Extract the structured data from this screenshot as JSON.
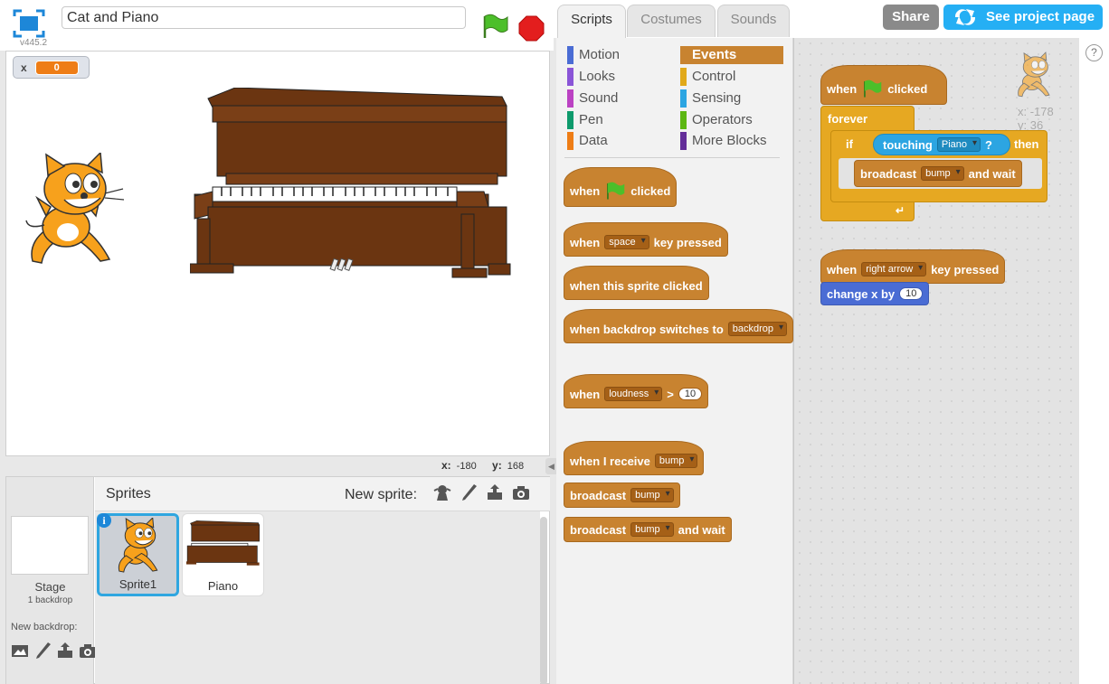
{
  "project": {
    "title": "Cat and Piano",
    "version": "v445.2"
  },
  "stage": {
    "variable": {
      "name": "x",
      "value": "0"
    },
    "coords": {
      "x_label": "x:",
      "x": "-180",
      "y_label": "y:",
      "y": "168"
    }
  },
  "tabs": [
    {
      "label": "Scripts",
      "active": true
    },
    {
      "label": "Costumes",
      "active": false
    },
    {
      "label": "Sounds",
      "active": false
    }
  ],
  "header_buttons": {
    "share": "Share",
    "see_project": "See project page"
  },
  "categories": {
    "left": [
      "Motion",
      "Looks",
      "Sound",
      "Pen",
      "Data"
    ],
    "right": [
      "Events",
      "Control",
      "Sensing",
      "Operators",
      "More Blocks"
    ],
    "colors": {
      "Motion": "#4a6cd4",
      "Looks": "#8a55d7",
      "Sound": "#bb42c3",
      "Pen": "#0e9a6c",
      "Data": "#ee7d16",
      "Events": "#c88330",
      "Control": "#e1a91a",
      "Sensing": "#2ca5e2",
      "Operators": "#5cb712",
      "More Blocks": "#632d99"
    },
    "active": "Events"
  },
  "palette_blocks": {
    "when_flag": {
      "when": "when",
      "clicked": "clicked"
    },
    "key_pressed": {
      "when": "when",
      "key": "space",
      "suffix": "key pressed"
    },
    "sprite_clicked": "when this sprite clicked",
    "backdrop_switch": {
      "text": "when backdrop switches to",
      "value": "backdrop"
    },
    "loudness": {
      "when": "when",
      "sensor": "loudness",
      "op": ">",
      "value": "10"
    },
    "receive": {
      "text": "when I receive",
      "value": "bump"
    },
    "broadcast": {
      "text": "broadcast",
      "value": "bump"
    },
    "broadcast_wait": {
      "text": "broadcast",
      "value": "bump",
      "suffix": "and wait"
    }
  },
  "script": {
    "sprite_x": "x: -178",
    "sprite_y": "y: 36",
    "hat_when": "when",
    "hat_clicked": "clicked",
    "forever": "forever",
    "if": "if",
    "touching": "touching",
    "touching_target": "Piano",
    "question": "?",
    "then": "then",
    "broadcast": "broadcast",
    "broadcast_msg": "bump",
    "and_wait": "and wait",
    "key_when": "when",
    "key_name": "right arrow",
    "key_pressed": "key pressed",
    "change_x": "change x by",
    "change_value": "10"
  },
  "sprites_pane": {
    "title": "Sprites",
    "new_sprite": "New sprite:",
    "stage_label": "Stage",
    "stage_sub": "1 backdrop",
    "new_backdrop": "New backdrop:",
    "sprites": [
      {
        "name": "Sprite1",
        "selected": true
      },
      {
        "name": "Piano",
        "selected": false
      }
    ],
    "info_badge": "i"
  }
}
